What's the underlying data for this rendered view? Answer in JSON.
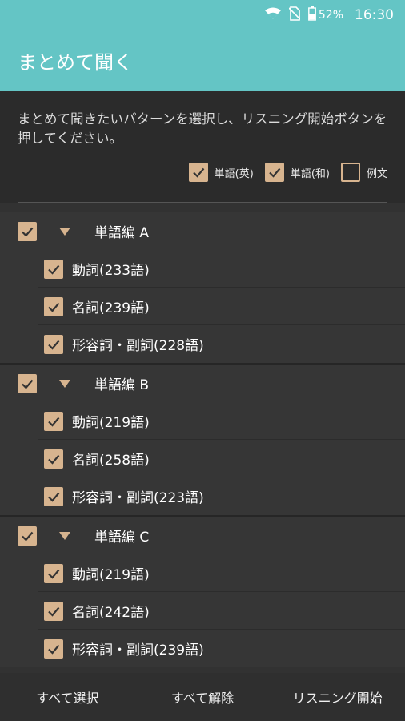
{
  "status_bar": {
    "battery": "52%",
    "time": "16:30"
  },
  "app_bar": {
    "title": "まとめて聞く"
  },
  "instruction": "まとめて聞きたいパターンを選択し、リスニング開始ボタンを押してください。",
  "filters": [
    {
      "label": "単語(英)",
      "checked": true
    },
    {
      "label": "単語(和)",
      "checked": true
    },
    {
      "label": "例文",
      "checked": false
    }
  ],
  "groups": [
    {
      "label": "単語編 A",
      "checked": true,
      "items": [
        {
          "label": "動詞(233語)",
          "checked": true
        },
        {
          "label": "名詞(239語)",
          "checked": true
        },
        {
          "label": "形容詞・副詞(228語)",
          "checked": true
        }
      ]
    },
    {
      "label": "単語編 B",
      "checked": true,
      "items": [
        {
          "label": "動詞(219語)",
          "checked": true
        },
        {
          "label": "名詞(258語)",
          "checked": true
        },
        {
          "label": "形容詞・副詞(223語)",
          "checked": true
        }
      ]
    },
    {
      "label": "単語編 C",
      "checked": true,
      "items": [
        {
          "label": "動詞(219語)",
          "checked": true
        },
        {
          "label": "名詞(242語)",
          "checked": true
        },
        {
          "label": "形容詞・副詞(239語)",
          "checked": true
        }
      ]
    }
  ],
  "bottom_bar": {
    "select_all": "すべて選択",
    "deselect_all": "すべて解除",
    "start_listening": "リスニング開始"
  },
  "colors": {
    "accent": "#64c5c5",
    "checkbox": "#d7b48f",
    "background": "#323232"
  }
}
